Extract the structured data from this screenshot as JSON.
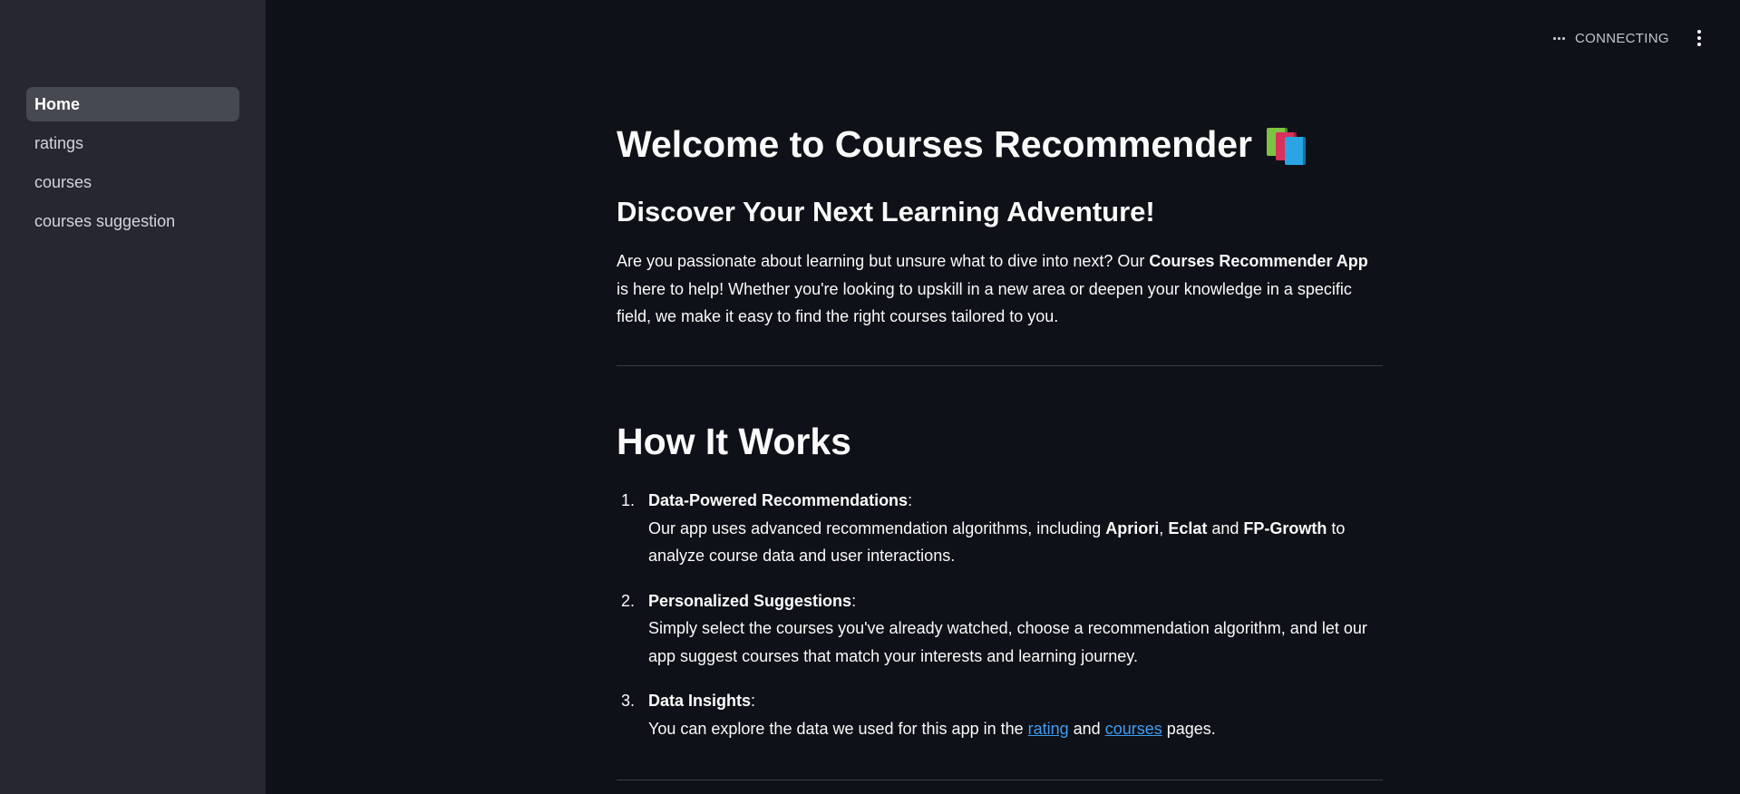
{
  "sidebar": {
    "items": [
      {
        "label": "Home",
        "active": true
      },
      {
        "label": "ratings"
      },
      {
        "label": "courses"
      },
      {
        "label": "courses suggestion"
      }
    ]
  },
  "header": {
    "status": "CONNECTING"
  },
  "main": {
    "title": "Welcome to Courses Recommender",
    "title_icon": "books-emoji-icon",
    "subtitle": "Discover Your Next Learning Adventure!",
    "intro": {
      "part1": "Are you passionate about learning but unsure what to dive into next? Our ",
      "bold": "Courses Recommender App",
      "part2": " is here to help! Whether you're looking to upskill in a new area or deepen your knowledge in a specific field, we make it easy to find the right courses tailored to you."
    },
    "how_title": "How It Works",
    "steps": [
      {
        "num": "1.",
        "heading": "Data-Powered Recommendations",
        "colon": ":",
        "text1": "Our app uses advanced recommendation algorithms, including ",
        "algo1": "Apriori",
        "sep1": ", ",
        "algo2": "Eclat",
        "sep2": " and ",
        "algo3": "FP-Growth",
        "text2": " to analyze course data and user interactions."
      },
      {
        "num": "2.",
        "heading": "Personalized Suggestions",
        "colon": ":",
        "text": "Simply select the courses you've already watched, choose a recommendation algorithm, and let our app suggest courses that match your interests and learning journey."
      },
      {
        "num": "3.",
        "heading": "Data Insights",
        "colon": ":",
        "text1": "You can explore the data we used for this app in the ",
        "link1": "rating",
        "mid": " and ",
        "link2": "courses",
        "text2": " pages."
      }
    ]
  },
  "colors": {
    "background": "#0e1117",
    "sidebar": "#262730",
    "link": "#3d9df3"
  }
}
